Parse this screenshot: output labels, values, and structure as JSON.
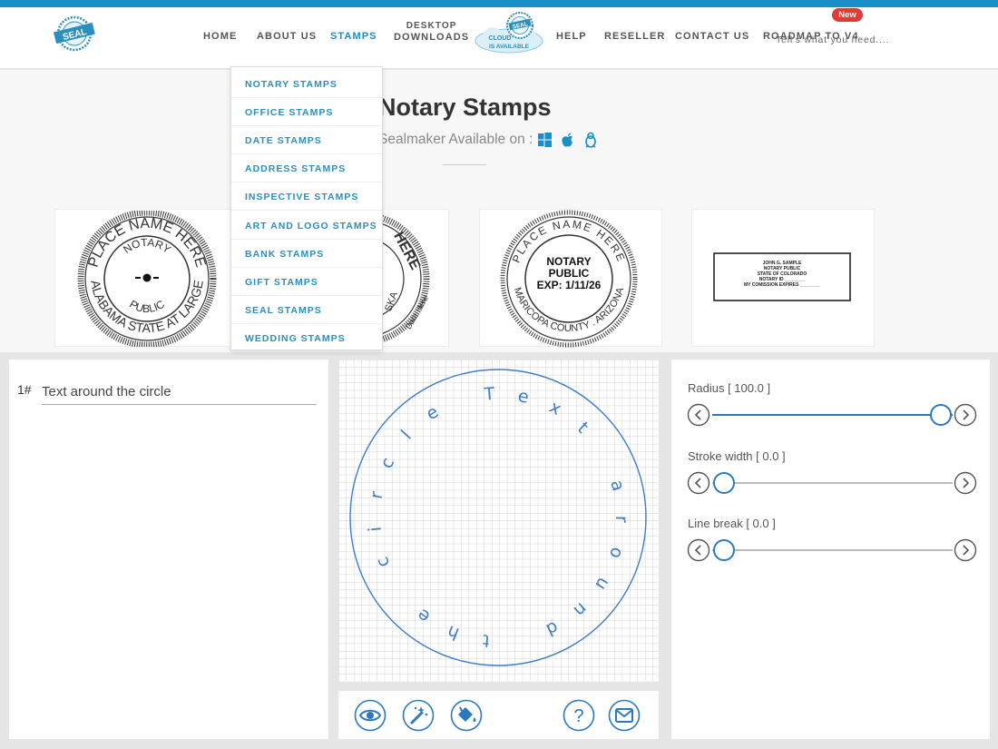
{
  "header": {
    "logo_text": "SEAL",
    "nav": [
      {
        "label": "HOME"
      },
      {
        "label": "ABOUT US"
      },
      {
        "label": "STAMPS"
      },
      {
        "line1": "DESKTOP",
        "line2": "DOWNLOADS"
      },
      {
        "label": "HELP"
      },
      {
        "label": "RESELLER"
      },
      {
        "label": "CONTACT US"
      },
      {
        "label": "ROADMAP TO V4",
        "badge": "New",
        "sub": "Tell's what you need...."
      }
    ],
    "cloud_badge": {
      "line1": "CLOUD",
      "seal": "SEAL",
      "line2": "IS AVAILABLE"
    }
  },
  "dropdown": {
    "items": [
      "NOTARY STAMPS",
      "OFFICE STAMPS",
      "DATE STAMPS",
      "ADDRESS STAMPS",
      "INSPECTIVE STAMPS",
      "ART AND LOGO STAMPS",
      "BANK STAMPS",
      "GIFT STAMPS",
      "SEAL STAMPS",
      "WEDDING STAMPS"
    ]
  },
  "hero": {
    "title": "Notary Stamps",
    "subtitle": "Sealmaker Available on :",
    "platforms": [
      "windows-icon",
      "apple-icon",
      "linux-icon"
    ]
  },
  "stamps": {
    "s1": {
      "outer_top": "PLACE NAME HERE",
      "inner_top": "NOTARY",
      "inner_bottom": "PUBLIC",
      "outer_bottom": "ALABAMA STATE AT LARGE"
    },
    "s2": {
      "outer_visible": "HERE",
      "side_left": "SKA",
      "side_inner": "Date Here"
    },
    "s3": {
      "outer_top": "PLACE NAME HERE",
      "center1": "NOTARY",
      "center2": "PUBLIC",
      "center3": "EXP: 1/11/26",
      "outer_bottom": "MARICOPA COUNTY . ARIZONA"
    },
    "s4": {
      "l1": "JOHN G. SAMPLE",
      "l2": "NOTARY PUBLIC",
      "l3": "STATE OF COLORADO",
      "l4": "NOTARY ID ________",
      "l5": "MY COMISSION EXPIRES ________"
    }
  },
  "editor": {
    "row_number": "1#",
    "text_value": "Text around the circle",
    "canvas_text": "Text around the circle",
    "sliders": [
      {
        "label": "Radius [ 100.0 ]",
        "value": 100.0,
        "fraction": 1.0
      },
      {
        "label": "Stroke width [ 0.0 ]",
        "value": 0.0,
        "fraction": 0.0
      },
      {
        "label": "Line break [ 0.0 ]",
        "value": 0.0,
        "fraction": 0.0
      }
    ],
    "toolbar": [
      "eye-icon",
      "magic-wand-icon",
      "paint-bucket-icon",
      "help-icon",
      "mail-icon"
    ]
  },
  "colors": {
    "accent": "#1a8ec6",
    "nav_active": "#1a8ec6",
    "link": "#2a8fbe",
    "badge": "#e53935",
    "control": "#2b78c0"
  }
}
